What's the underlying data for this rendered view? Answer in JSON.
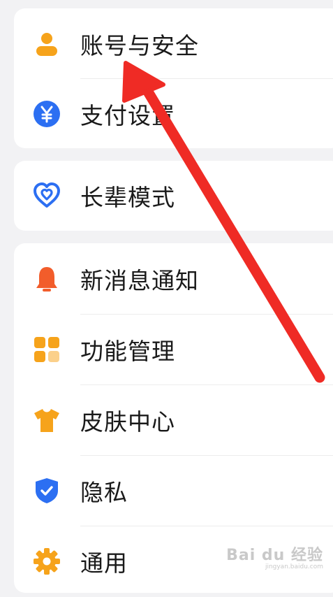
{
  "groups": [
    {
      "items": [
        {
          "label": "账号与安全",
          "icon": "person-icon"
        },
        {
          "label": "支付设置",
          "icon": "yen-icon"
        }
      ]
    },
    {
      "items": [
        {
          "label": "长辈模式",
          "icon": "heart-icon"
        }
      ]
    },
    {
      "items": [
        {
          "label": "新消息通知",
          "icon": "bell-icon"
        },
        {
          "label": "功能管理",
          "icon": "grid-icon"
        },
        {
          "label": "皮肤中心",
          "icon": "tshirt-icon"
        },
        {
          "label": "隐私",
          "icon": "shield-check-icon"
        },
        {
          "label": "通用",
          "icon": "gear-icon"
        }
      ]
    }
  ],
  "colors": {
    "orange": "#f6a31b",
    "blue": "#2c6ff2",
    "bell": "#f25d2b",
    "arrow": "#ef2b25",
    "background": "#f2f2f4"
  },
  "watermark": {
    "mark": "Bai du 经验",
    "url": "jingyan.baidu.com"
  }
}
